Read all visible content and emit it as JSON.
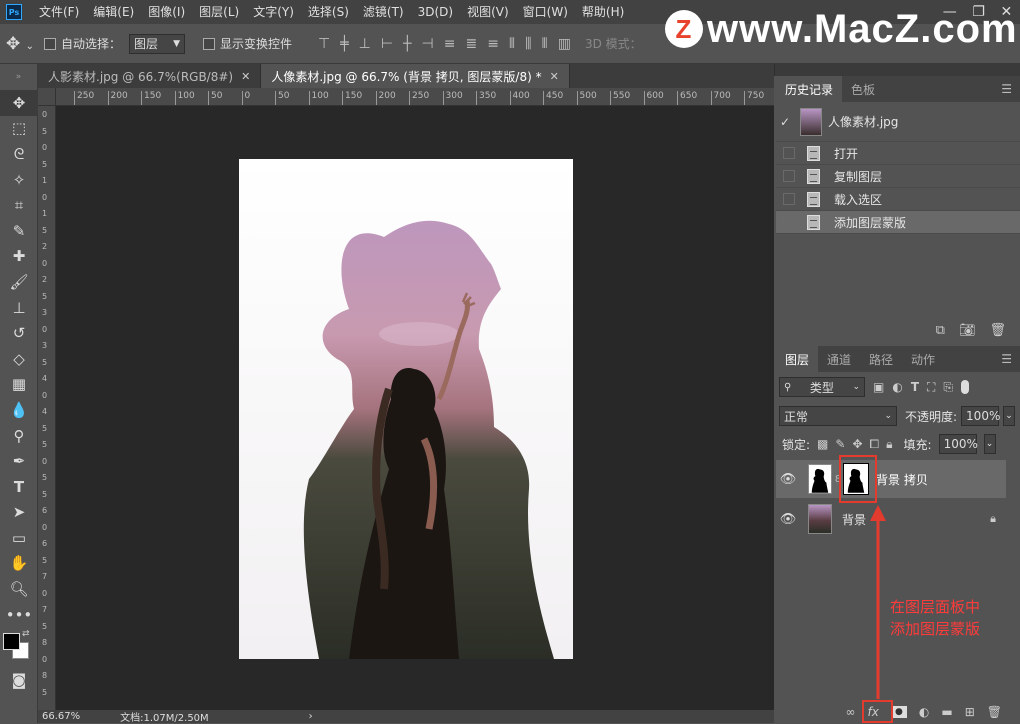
{
  "menubar": {
    "items": [
      "文件(F)",
      "编辑(E)",
      "图像(I)",
      "图层(L)",
      "文字(Y)",
      "选择(S)",
      "滤镜(T)",
      "3D(D)",
      "视图(V)",
      "窗口(W)",
      "帮助(H)"
    ]
  },
  "watermark": {
    "badge": "Z",
    "text": "www.MacZ.com"
  },
  "options": {
    "auto_select_label": "自动选择：",
    "auto_select_value": "图层",
    "show_transform_label": "显示变换控件",
    "mode_3d_label": "3D 模式："
  },
  "tabs": [
    {
      "label": "人影素材.jpg @ 66.7%(RGB/8#)"
    },
    {
      "label": "人像素材.jpg @ 66.7% (背景 拷贝, 图层蒙版/8) *"
    }
  ],
  "ruler": {
    "top_ticks": [
      "250",
      "200",
      "150",
      "100",
      "50",
      "0",
      "50",
      "100",
      "150",
      "200",
      "250",
      "300",
      "350",
      "400",
      "450",
      "500",
      "550",
      "600",
      "650",
      "700",
      "750"
    ],
    "left_ticks": [
      "0",
      "5",
      "0",
      "5",
      "1",
      "0",
      "1",
      "5",
      "2",
      "0",
      "2",
      "5",
      "3",
      "0",
      "3",
      "5",
      "4",
      "0",
      "4",
      "5",
      "5",
      "0",
      "5",
      "5",
      "6",
      "0",
      "6",
      "5",
      "7",
      "0",
      "7",
      "5",
      "8",
      "0",
      "8",
      "5"
    ]
  },
  "status": {
    "zoom": "66.67%",
    "doc": "文档:1.07M/2.50M"
  },
  "history": {
    "tabs": [
      "历史记录",
      "色板"
    ],
    "snapshot_name": "人像素材.jpg",
    "steps": [
      "打开",
      "复制图层",
      "载入选区",
      "添加图层蒙版"
    ],
    "selected_index": 3
  },
  "layers": {
    "tabs": [
      "图层",
      "通道",
      "路径",
      "动作"
    ],
    "filter_label": "类型",
    "blend_mode": "正常",
    "opacity_label": "不透明度:",
    "opacity_value": "100%",
    "lock_label": "锁定:",
    "fill_label": "填充:",
    "fill_value": "100%",
    "items": [
      {
        "name": "背景 拷贝",
        "selected": true,
        "has_mask": true
      },
      {
        "name": "背景",
        "selected": false,
        "locked": true
      }
    ],
    "footer_fx": "fx"
  },
  "annotation": {
    "line1": "在图层面板中",
    "line2": "添加图层蒙版",
    "color": "#ff3b3b"
  },
  "colors": {
    "accent": "#31a8ff",
    "highlight_red": "#e43b2f"
  }
}
